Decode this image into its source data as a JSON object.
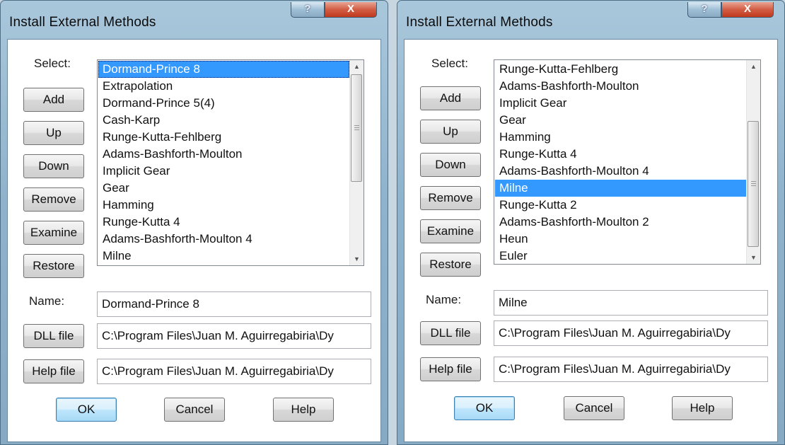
{
  "dialogs": [
    {
      "title": "Install External Methods",
      "help_glyph": "?",
      "close_glyph": "X",
      "select_label": "Select:",
      "buttons": {
        "add": "Add",
        "up": "Up",
        "down": "Down",
        "remove": "Remove",
        "examine": "Examine",
        "restore": "Restore"
      },
      "list_items": [
        "Dormand-Prince 8",
        "Extrapolation",
        "Dormand-Prince 5(4)",
        "Cash-Karp",
        "Runge-Kutta-Fehlberg",
        "Adams-Bashforth-Moulton",
        "Implicit Gear",
        "Gear",
        "Hamming",
        "Runge-Kutta 4",
        "Adams-Bashforth-Moulton 4",
        "Milne"
      ],
      "selected_item": "Dormand-Prince 8",
      "name_label": "Name:",
      "name_value": "Dormand-Prince 8",
      "dll_button": "DLL file",
      "dll_value": "C:\\Program Files\\Juan M. Aguirregabiria\\Dy",
      "helpfile_button": "Help file",
      "helpfile_value": "C:\\Program Files\\Juan M. Aguirregabiria\\Dy",
      "ok": "OK",
      "cancel": "Cancel",
      "help": "Help"
    },
    {
      "title": "Install External Methods",
      "help_glyph": "?",
      "close_glyph": "X",
      "select_label": "Select:",
      "buttons": {
        "add": "Add",
        "up": "Up",
        "down": "Down",
        "remove": "Remove",
        "examine": "Examine",
        "restore": "Restore"
      },
      "list_items": [
        "Runge-Kutta-Fehlberg",
        "Adams-Bashforth-Moulton",
        "Implicit Gear",
        "Gear",
        "Hamming",
        "Runge-Kutta 4",
        "Adams-Bashforth-Moulton 4",
        "Milne",
        "Runge-Kutta 2",
        "Adams-Bashforth-Moulton 2",
        "Heun",
        "Euler"
      ],
      "selected_item": "Milne",
      "name_label": "Name:",
      "name_value": "Milne",
      "dll_button": "DLL file",
      "dll_value": "C:\\Program Files\\Juan M. Aguirregabiria\\Dy",
      "helpfile_button": "Help file",
      "helpfile_value": "C:\\Program Files\\Juan M. Aguirregabiria\\Dy",
      "ok": "OK",
      "cancel": "Cancel",
      "help": "Help"
    }
  ]
}
